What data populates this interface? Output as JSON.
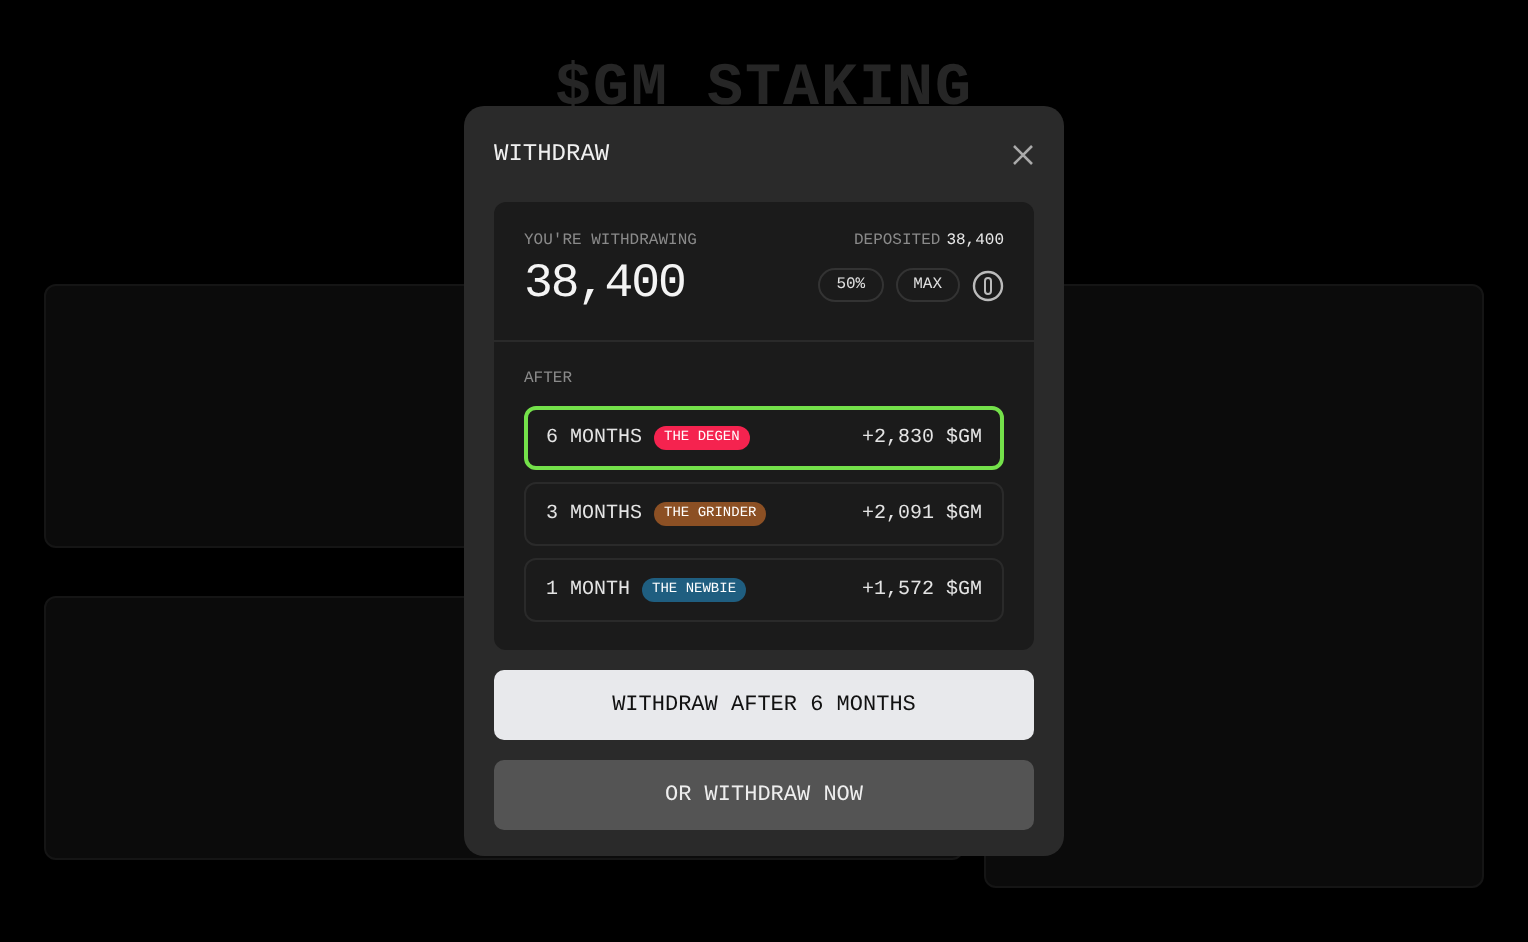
{
  "background": {
    "title": "$GM STAKING"
  },
  "modal": {
    "title": "WITHDRAW",
    "amount_label": "YOU'RE WITHDRAWING",
    "amount": "38,400",
    "deposited_label": "DEPOSITED",
    "deposited_value": "38,400",
    "quick_buttons": [
      "50%",
      "MAX"
    ],
    "after_label": "AFTER",
    "options": [
      {
        "duration": "6 MONTHS",
        "tag": "THE DEGEN",
        "color": "#f5234f",
        "reward": "+2,830 $GM",
        "selected": true
      },
      {
        "duration": "3 MONTHS",
        "tag": "THE GRINDER",
        "color": "#8c5024",
        "reward": "+2,091 $GM",
        "selected": false
      },
      {
        "duration": "1 MONTH",
        "tag": "THE NEWBIE",
        "color": "#1f5e80",
        "reward": "+1,572 $GM",
        "selected": false
      }
    ],
    "primary_button": "WITHDRAW AFTER 6 MONTHS",
    "secondary_button": "OR WITHDRAW NOW"
  }
}
